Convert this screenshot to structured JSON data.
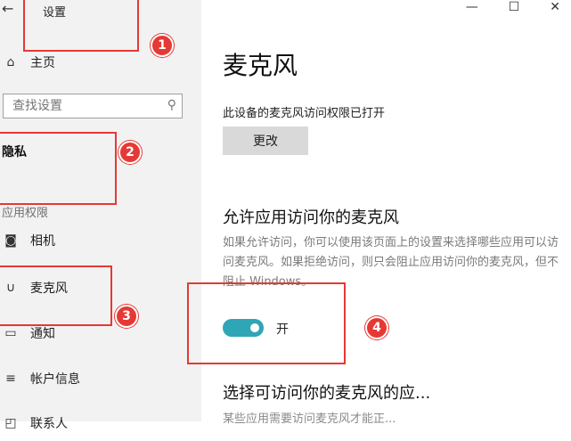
{
  "window": {
    "title": "设置",
    "back_icon": "←",
    "controls": [
      "—",
      "☐",
      "✕"
    ]
  },
  "sidebar": {
    "home": {
      "icon": "⌂",
      "label": "主页"
    },
    "search": {
      "placeholder": "查找设置",
      "icon": "⚲"
    },
    "privacy_label": "隐私",
    "section_label": "应用权限",
    "items": [
      {
        "icon": "◙",
        "label": "相机"
      },
      {
        "icon": "∪",
        "label": "麦克风"
      },
      {
        "icon": "▭",
        "label": "通知"
      },
      {
        "icon": "≡",
        "label": "帐户信息"
      },
      {
        "icon": "◰",
        "label": "联系人"
      }
    ]
  },
  "main": {
    "title": "麦克风",
    "status": "此设备的麦克风访问权限已打开",
    "change_button": "更改",
    "allow_heading": "允许应用访问你的麦克风",
    "allow_desc": "如果允许访问，你可以使用该页面上的设置来选择哪些应用可以访问麦克风。如果拒绝访问，则只会阻止应用访问你的麦克风，但不阻止 Windows。",
    "toggle_label": "开",
    "toggle_on": true,
    "choose_heading": "选择可访问你的麦克风的应...",
    "choose_desc": "某些应用需要访问麦克风才能正..."
  },
  "annotations": {
    "accent": "#e53935",
    "badges": [
      "1",
      "2",
      "3",
      "4"
    ]
  }
}
